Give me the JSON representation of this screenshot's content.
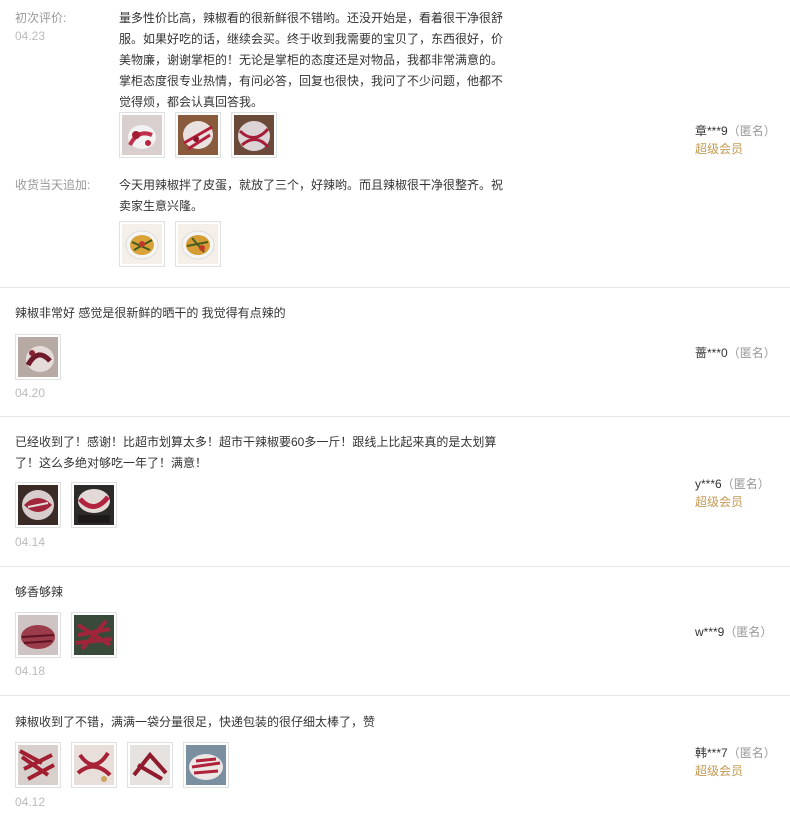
{
  "reviews": [
    {
      "initial_label": "初次评价:",
      "date": "04.23",
      "text_lines": [
        "量多性价比高，辣椒看的很新鲜很不错哟。还没开始是，看着很干净很舒",
        "服。如果好吃的话，继续会买。终于收到我需要的宝贝了，东西很好，价",
        "美物廉，谢谢掌柜的！无论是掌柜的态度还是对物品，我都非常满意的。",
        "掌柜态度很专业热情，有问必答，回复也很快，我问了不少问题，他都不",
        "觉得烦，都会认真回答我。"
      ],
      "followup_label": "收货当天追加:",
      "followup_lines": [
        "今天用辣椒拌了皮蛋，就放了三个，好辣哟。而且辣椒很干净很整齐。祝",
        "卖家生意兴隆。"
      ],
      "user": "章***9",
      "anon": "（匿名）",
      "vip": "超级会员"
    },
    {
      "text": "辣椒非常好 感觉是很新鲜的晒干的 我觉得有点辣的",
      "date": "04.20",
      "user": "蔷***0",
      "anon": "（匿名）"
    },
    {
      "text_lines": [
        "已经收到了！感谢！比超市划算太多！超市干辣椒要60多一斤！跟线上比起来真的是太划算",
        "了！这么多绝对够吃一年了！满意！"
      ],
      "date": "04.14",
      "user": "y***6",
      "anon": "（匿名）",
      "vip": "超级会员"
    },
    {
      "text": "够香够辣",
      "date": "04.18",
      "user": "w***9",
      "anon": "（匿名）"
    },
    {
      "text": "辣椒收到了不错，满满一袋分量很足，快递包装的很仔细太棒了，赞",
      "date": "04.12",
      "user": "韩***7",
      "anon": "（匿名）",
      "vip": "超级会员"
    }
  ],
  "colors": {
    "text": "#333333",
    "muted": "#999999",
    "date": "#bbbbbb",
    "vip": "#c39a53",
    "divider": "#e5e5e5"
  }
}
